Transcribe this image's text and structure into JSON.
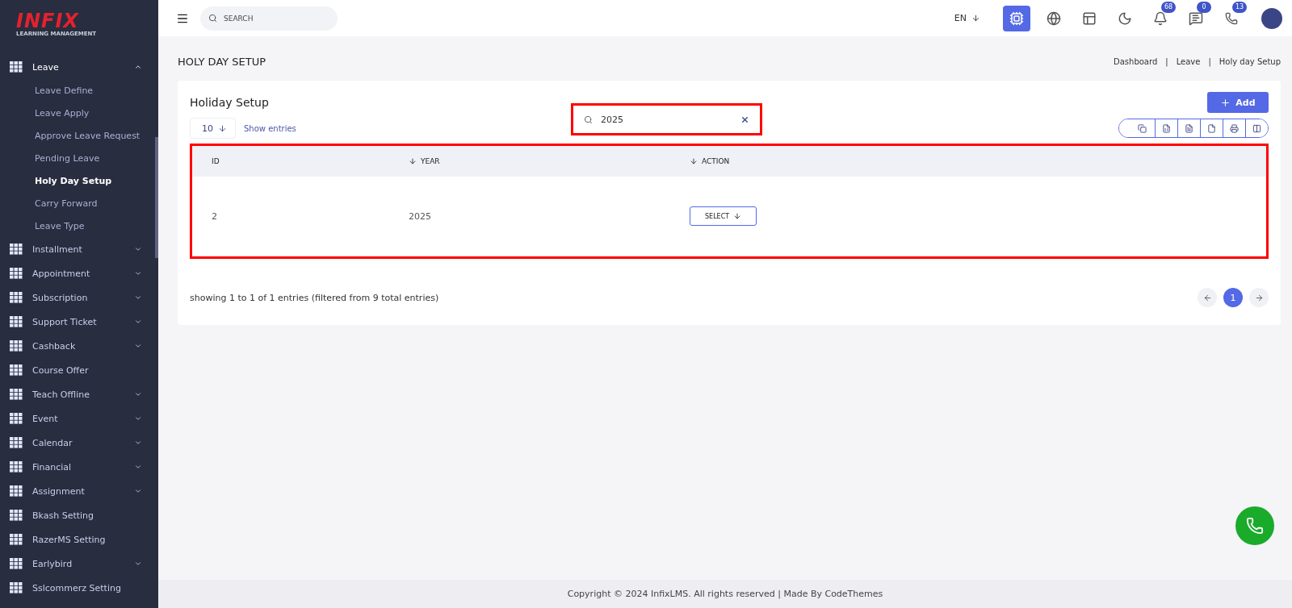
{
  "logo": {
    "brand": "INFIX",
    "tagline": "LEARNING MANAGEMENT"
  },
  "sidebar": {
    "items": [
      {
        "label": "Leave",
        "expanded": true,
        "children": [
          {
            "label": "Leave Define",
            "selected": false
          },
          {
            "label": "Leave Apply",
            "selected": false
          },
          {
            "label": "Approve Leave Request",
            "selected": false
          },
          {
            "label": "Pending Leave",
            "selected": false
          },
          {
            "label": "Holy Day Setup",
            "selected": true
          },
          {
            "label": "Carry Forward",
            "selected": false
          },
          {
            "label": "Leave Type",
            "selected": false
          }
        ]
      },
      {
        "label": "Installment",
        "expanded": false
      },
      {
        "label": "Appointment",
        "expanded": false
      },
      {
        "label": "Subscription",
        "expanded": false
      },
      {
        "label": "Support Ticket",
        "expanded": false
      },
      {
        "label": "Cashback",
        "expanded": false
      },
      {
        "label": "Course Offer"
      },
      {
        "label": "Teach Offline",
        "expanded": false
      },
      {
        "label": "Event",
        "expanded": false
      },
      {
        "label": "Calendar",
        "expanded": false
      },
      {
        "label": "Financial",
        "expanded": false
      },
      {
        "label": "Assignment",
        "expanded": false
      },
      {
        "label": "Bkash Setting"
      },
      {
        "label": "RazerMS Setting"
      },
      {
        "label": "Earlybird",
        "expanded": false
      },
      {
        "label": "Sslcommerz Setting"
      }
    ]
  },
  "header": {
    "search_placeholder": "SEARCH",
    "language": "EN",
    "badges": {
      "notifications": "68",
      "messages": "0",
      "chat": "13"
    }
  },
  "page_title": "HOLY DAY SETUP",
  "breadcrumb": [
    {
      "label": "Dashboard"
    },
    {
      "separator": "|",
      "label": "Leave"
    },
    {
      "separator": "|",
      "label": "Holy day Setup"
    }
  ],
  "card": {
    "title": "Holiday Setup",
    "add_button": "Add",
    "page_size": "10",
    "show_entries": "Show entries",
    "search_value": "2025",
    "columns": [
      {
        "label": "ID",
        "sortable": false
      },
      {
        "label": "YEAR",
        "sortable": true
      },
      {
        "label": "ACTION",
        "sortable": true
      }
    ],
    "rows": [
      {
        "id": "2",
        "year": "2025",
        "action": "SELECT"
      }
    ],
    "summary": "showing 1 to 1 of 1 entries (filtered from 9 total entries)",
    "pages": [
      {
        "label": "1",
        "selected": true
      }
    ]
  },
  "footer": "Copyright © 2024 InfixLMS. All rights reserved | Made By CodeThemes"
}
